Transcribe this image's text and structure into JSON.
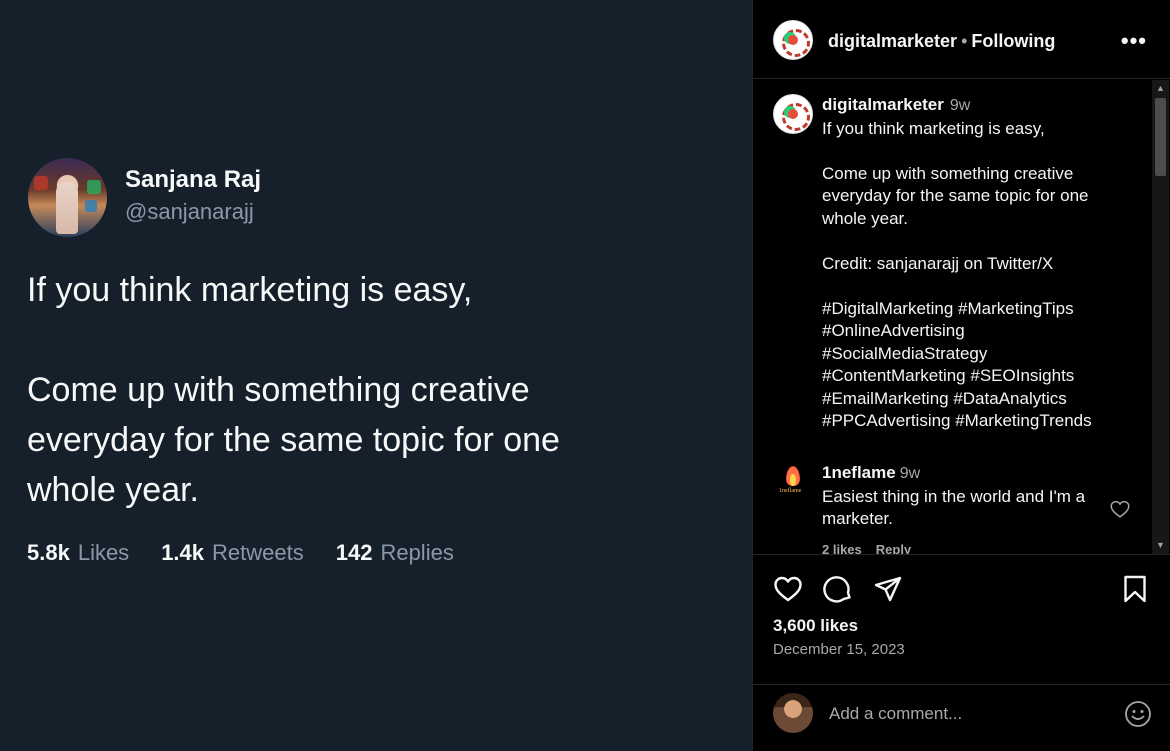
{
  "tweet": {
    "name": "Sanjana Raj",
    "handle": "@sanjanarajj",
    "lines": [
      "If you think marketing is easy,",
      "Come up with something creative",
      "everyday for the same topic for one",
      "whole year."
    ],
    "stats": [
      {
        "value": "5.8k",
        "label": "Likes"
      },
      {
        "value": "1.4k",
        "label": "Retweets"
      },
      {
        "value": "142",
        "label": "Replies"
      }
    ]
  },
  "instagram": {
    "header": {
      "username": "digitalmarketer",
      "separator": "•",
      "follow_state": "Following",
      "more_icon": "more-horizontal-icon"
    },
    "caption": {
      "username": "digitalmarketer",
      "time": "9w",
      "lines": [
        "If you think marketing is easy,",
        "",
        "Come up with something creative",
        "everyday for the same topic for one",
        "whole year.",
        "",
        "Credit: sanjanarajj on Twitter/X",
        "",
        "#DigitalMarketing #MarketingTips",
        "#OnlineAdvertising",
        "#SocialMediaStrategy",
        "#ContentMarketing #SEOInsights",
        "#EmailMarketing #DataAnalytics",
        "#PPCAdvertising #MarketingTrends"
      ]
    },
    "comment": {
      "username": "1neflame",
      "time": "9w",
      "lines": [
        "Easiest thing in the world and I'm a",
        "marketer."
      ],
      "likes": "2 likes",
      "reply": "Reply"
    },
    "actions": {
      "icons": [
        "heart-icon",
        "comment-icon",
        "share-icon",
        "bookmark-icon"
      ],
      "likes": "3,600 likes",
      "date": "December 15, 2023"
    },
    "add_comment": {
      "placeholder": "Add a comment...",
      "emoji_icon": "smile-icon"
    }
  }
}
